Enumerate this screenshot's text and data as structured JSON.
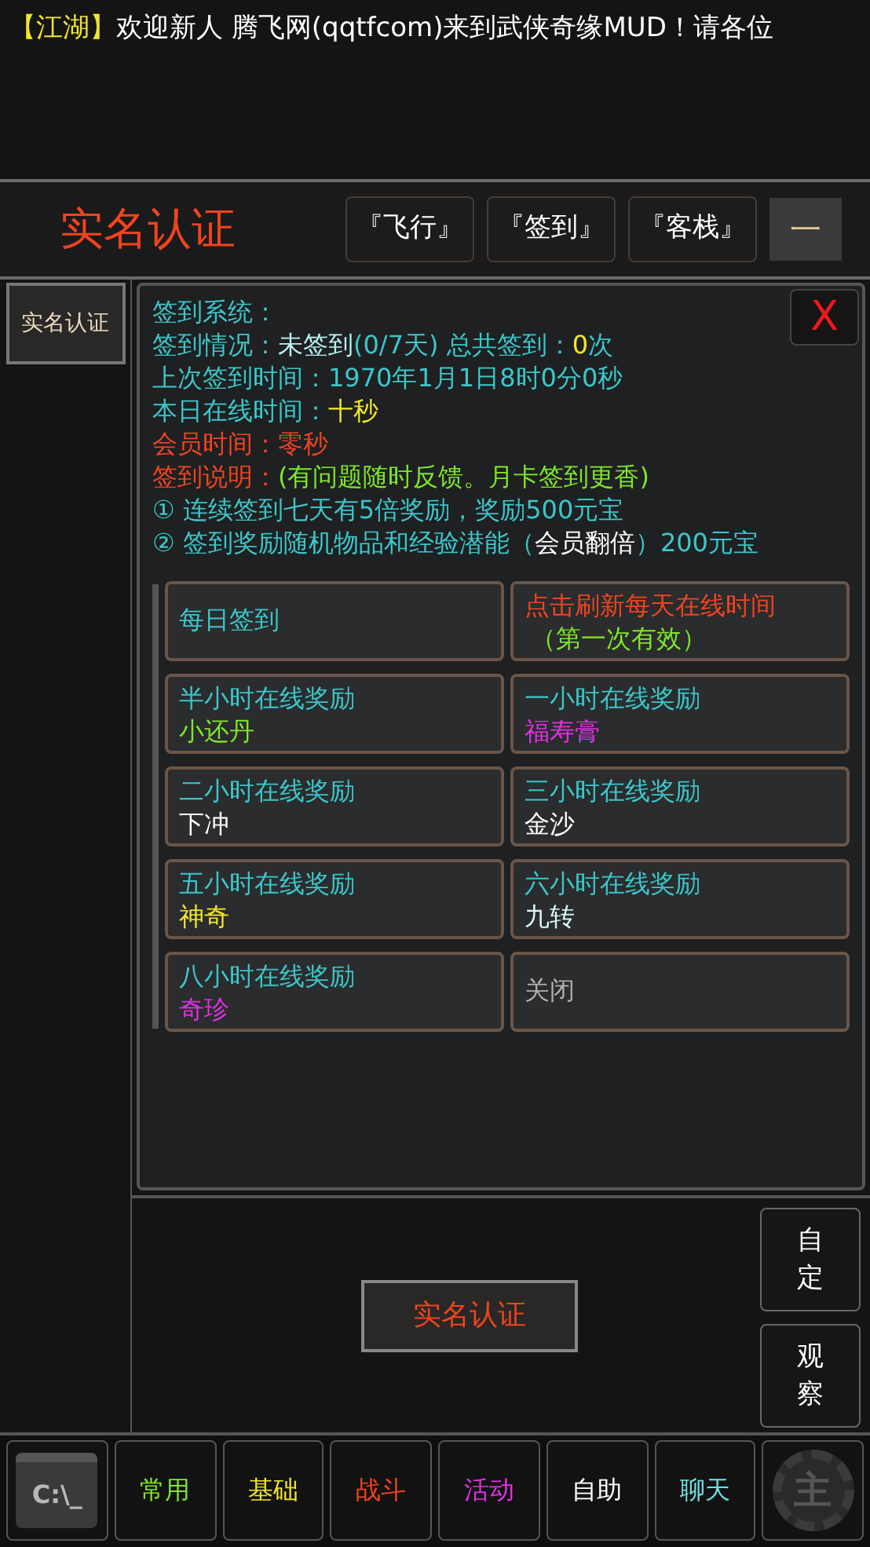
{
  "marquee": [
    {
      "text": "【江湖】",
      "color": "#f2e52a"
    },
    {
      "text": "欢迎新人  腾飞网(qqtfcom)来到武侠奇缘MUD！请各位",
      "color": "#ffffff"
    }
  ],
  "header": {
    "title": "实名认证",
    "buttons": [
      "『飞行』",
      "『签到』",
      "『客栈』"
    ],
    "minimize": "一"
  },
  "side_button": "实名认证",
  "panel": {
    "close": "X",
    "lines": [
      [
        {
          "text": "签到系统：",
          "color": "#3cc6c8"
        }
      ],
      [
        {
          "text": "签到情况：",
          "color": "#3cc6c8"
        },
        {
          "text": "未签到",
          "color": "#b8f0ee"
        },
        {
          "text": "(0/7天)  总共签到：",
          "color": "#3cc6c8"
        },
        {
          "text": "0",
          "color": "#f2e52a"
        },
        {
          "text": "次",
          "color": "#3cc6c8"
        }
      ],
      [
        {
          "text": "上次签到时间：1970年1月1日8时0分0秒",
          "color": "#3cc6c8"
        }
      ],
      [
        {
          "text": "本日在线时间：",
          "color": "#3cc6c8"
        },
        {
          "text": "十秒",
          "color": "#f2e52a"
        }
      ],
      [
        {
          "text": "会员时间：零秒",
          "color": "#f0441e"
        }
      ],
      [
        {
          "text": "签到说明：",
          "color": "#f0441e"
        },
        {
          "text": "(有问题随时反馈。月卡签到更香)",
          "color": "#7fe62a"
        }
      ],
      [
        {
          "text": "① 连续签到七天有5倍奖励，奖励500元宝",
          "color": "#3cc6c8"
        }
      ],
      [
        {
          "text": "② 签到奖励随机物品和经验潜能（",
          "color": "#3cc6c8"
        },
        {
          "text": "会员翻倍",
          "color": "#ffffff"
        },
        {
          "text": "）200元宝",
          "color": "#3cc6c8"
        }
      ]
    ],
    "grid": [
      {
        "kind": "single",
        "label": "每日签到",
        "color": "#3cc6c8"
      },
      {
        "kind": "refresh",
        "label": "点击刷新每天在线时间",
        "color": "#f0441e",
        "sub": {
          "text": "（第一次有效）",
          "color": "#7fe62a"
        }
      },
      {
        "kind": "reward",
        "label": "半小时在线奖励",
        "color": "#3cc6c8",
        "sub": {
          "text": "小还丹",
          "color": "#7fe62a"
        }
      },
      {
        "kind": "reward",
        "label": "一小时在线奖励",
        "color": "#3cc6c8",
        "sub": {
          "text": "福寿膏",
          "color": "#e030e0"
        }
      },
      {
        "kind": "reward",
        "label": "二小时在线奖励",
        "color": "#3cc6c8",
        "sub": {
          "text": "下冲",
          "color": "#ffffff"
        }
      },
      {
        "kind": "reward",
        "label": "三小时在线奖励",
        "color": "#3cc6c8",
        "sub": {
          "text": "金沙",
          "color": "#ffffff"
        }
      },
      {
        "kind": "reward",
        "label": "五小时在线奖励",
        "color": "#3cc6c8",
        "sub": {
          "text": "神奇",
          "color": "#f2e52a"
        }
      },
      {
        "kind": "reward",
        "label": "六小时在线奖励",
        "color": "#3cc6c8",
        "sub": {
          "text": "九转",
          "color": "#d8f8f8"
        }
      },
      {
        "kind": "reward",
        "label": "八小时在线奖励",
        "color": "#3cc6c8",
        "sub": {
          "text": "奇珍",
          "color": "#e030e0"
        }
      },
      {
        "kind": "single",
        "label": "关闭",
        "color": "#b0b0b0"
      }
    ]
  },
  "action_button": "实名认证",
  "side_actions": [
    "自定",
    "观察"
  ],
  "console_icon": "C:\\_",
  "tabs": [
    {
      "label": "常用",
      "color": "#7fe62a"
    },
    {
      "label": "基础",
      "color": "#f2e52a"
    },
    {
      "label": "战斗",
      "color": "#f0441e"
    },
    {
      "label": "活动",
      "color": "#e030e0"
    },
    {
      "label": "自助",
      "color": "#ffffff"
    },
    {
      "label": "聊天",
      "color": "#6fe0e0"
    }
  ],
  "gear_icon": "主"
}
